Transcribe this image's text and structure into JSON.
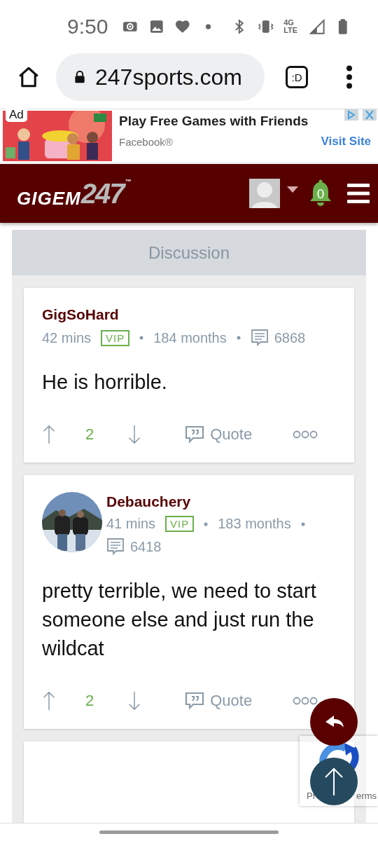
{
  "status_bar": {
    "time": "9:50",
    "network": "4G LTE"
  },
  "browser": {
    "url": "247sports.com",
    "tab_label": ":D"
  },
  "ad": {
    "label": "Ad",
    "title": "Play Free Games with Friends",
    "source": "Facebook®",
    "action": "Visit Site"
  },
  "header": {
    "logo_word": "GIGEM",
    "logo_number": "247",
    "logo_mark": "™",
    "notifications": "0"
  },
  "discussion": {
    "title": "Discussion",
    "posts": [
      {
        "author": "GigSoHard",
        "avatar": false,
        "time": "42 mins",
        "badge": "VIP",
        "tenure": "184 months",
        "post_count": "6868",
        "body": "He is horrible.",
        "score": "2",
        "quote": "Quote",
        "more": true
      },
      {
        "author": "Debauchery",
        "avatar": true,
        "time": "41 mins",
        "badge": "VIP",
        "tenure": "183 months",
        "post_count": "6418",
        "body": "pretty terrible, we need to start someone else and just run the wildcat",
        "score": "2",
        "quote": "Quote",
        "more": true
      }
    ]
  },
  "recaptcha": {
    "left_text": "Pr",
    "right_text": "erms"
  }
}
